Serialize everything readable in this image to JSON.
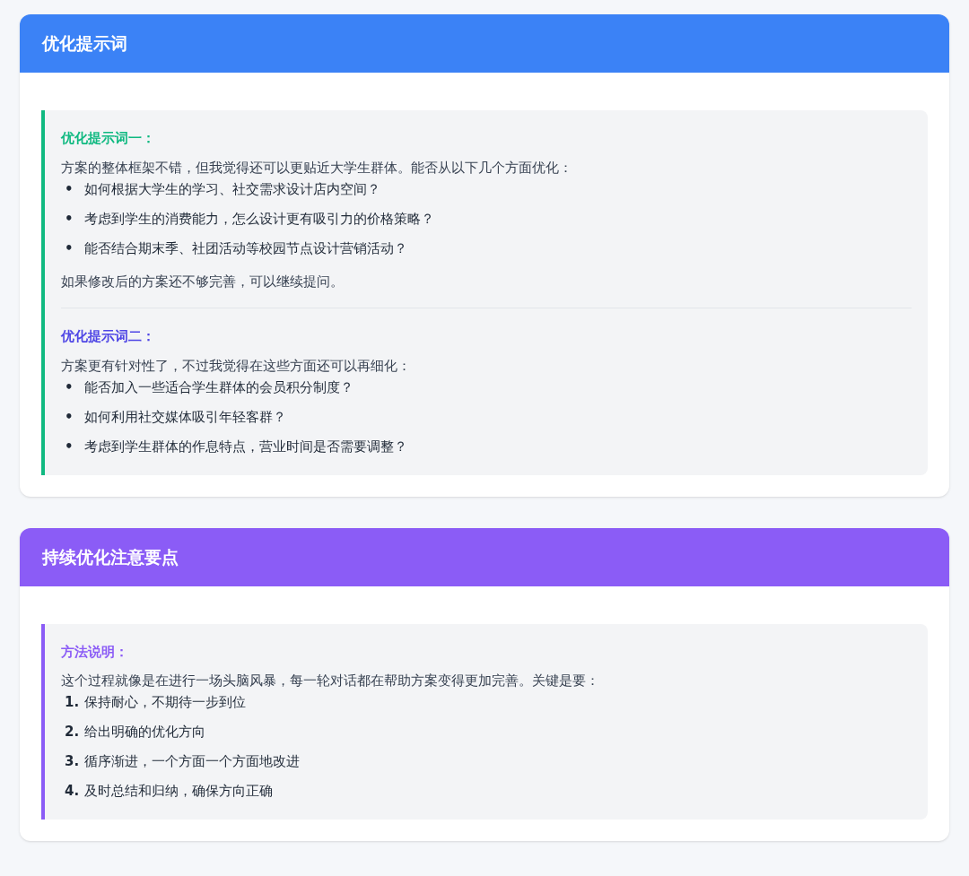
{
  "cards": [
    {
      "title": "优化提示词",
      "color": "#3b82f6",
      "bar": {
        "color": "#10b981"
      },
      "sections": [
        {
          "heading": "优化提示词一：",
          "color": "#10b981",
          "intro": "方案的整体框架不错，但我觉得还可以更贴近大学生群体。能否从以下几个方面优化：",
          "items": [
            {
              "marker": "•",
              "text": "如何根据大学生的学习、社交需求设计店内空间？"
            },
            {
              "marker": "•",
              "text": "考虑到学生的消费能力，怎么设计更有吸引力的价格策略？"
            },
            {
              "marker": "•",
              "text": "能否结合期末季、社团活动等校园节点设计营销活动？"
            }
          ],
          "outro": "如果修改后的方案还不够完善，可以继续提问。"
        },
        {
          "heading": "优化提示词二：",
          "color": "#4f46e5",
          "intro": "方案更有针对性了，不过我觉得在这些方面还可以再细化：",
          "items": [
            {
              "marker": "•",
              "text": "能否加入一些适合学生群体的会员积分制度？"
            },
            {
              "marker": "•",
              "text": "如何利用社交媒体吸引年轻客群？"
            },
            {
              "marker": "•",
              "text": "考虑到学生群体的作息特点，营业时间是否需要调整？"
            }
          ]
        }
      ]
    },
    {
      "title": "持续优化注意要点",
      "color": "#8b5cf6",
      "bar": {
        "color": "#8b5cf6"
      },
      "sections": [
        {
          "heading": "方法说明：",
          "color": "#8b5cf6",
          "intro": "这个过程就像是在进行一场头脑风暴，每一轮对话都在帮助方案变得更加完善。关键是要：",
          "items": [
            {
              "marker": "1.",
              "text": "保持耐心，不期待一步到位"
            },
            {
              "marker": "2.",
              "text": "给出明确的优化方向"
            },
            {
              "marker": "3.",
              "text": "循序渐进，一个方面一个方面地改进"
            },
            {
              "marker": "4.",
              "text": "及时总结和归纳，确保方向正确"
            }
          ]
        }
      ]
    }
  ]
}
